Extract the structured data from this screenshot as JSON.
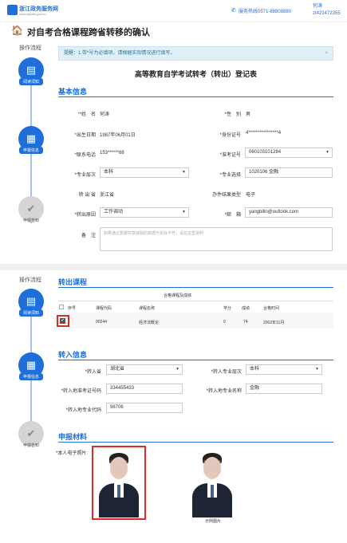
{
  "header": {
    "logo_title": "浙江政务服务网",
    "logo_sub": "www.zjzwfw.gov.cn",
    "hotline": "服务热线0571-88808880",
    "user": "何涛 zt421472355"
  },
  "page_title": "对自考合格课程跨省转移的确认",
  "steps_label": "操作流程",
  "steps": [
    {
      "label": "阅读须知",
      "icon": "book-icon"
    },
    {
      "label": "申报信息",
      "icon": "document-icon"
    },
    {
      "label": "申报告知",
      "icon": "check-icon"
    }
  ],
  "notice": "提醒：1.带*号为必填项，请根据实际情况进行填写。",
  "form_title": "高等教育自学考试转考（转出）登记表",
  "basic": {
    "section": "基本信息",
    "name_label": "*姓　名",
    "name": "何涛",
    "gender_label": "*性　别",
    "gender": "男",
    "birth_label": "*出生日期",
    "birth": "1987年06月01日",
    "id_label": "*身份证号",
    "id": "4****************4",
    "phone_label": "*联系电话",
    "phone": "153******88",
    "exam_label": "*准考证号",
    "exam": "060103101284",
    "level_label": "*专业层次",
    "level": "本科",
    "major_label": "*专业选择",
    "major": "1020106 金融",
    "out_label": "转 出 省",
    "out": "浙江省",
    "result_label": "办件结果类型",
    "result": "电子",
    "reason_label": "*转出原因",
    "reason": "工作调动",
    "mail_label": "*邮　箱",
    "mail": "yangbilin@outlook.com",
    "remark_label": "备　注",
    "remark_placeholder": "如果通过数据共享获取的数据与实际不符，请在这里说明"
  },
  "transfer_out": {
    "section": "转出课程",
    "table_title": "合格课程及成绩",
    "headers": [
      "序号",
      "课程代码",
      "课程名称",
      "学分",
      "成绩",
      "合格时间"
    ],
    "rows": [
      {
        "code": "00244",
        "name": "经济法概论",
        "credit": "0",
        "score": "74",
        "time": "2002年11月"
      }
    ]
  },
  "transfer_in": {
    "section": "转入信息",
    "province_label": "*转入省",
    "province": "湖北省",
    "level_label": "*转入专业层次",
    "level": "本科",
    "exam_label": "*转入地准考证号码",
    "exam": "334455433",
    "major_name_label": "*转入地专业名称",
    "major_name": "金融",
    "major_code_label": "*转入地专业代码",
    "major_code": "98706"
  },
  "materials": {
    "section": "申报材料",
    "photo_label": "*本人电子照片:",
    "sample_caption": "示例图片"
  }
}
